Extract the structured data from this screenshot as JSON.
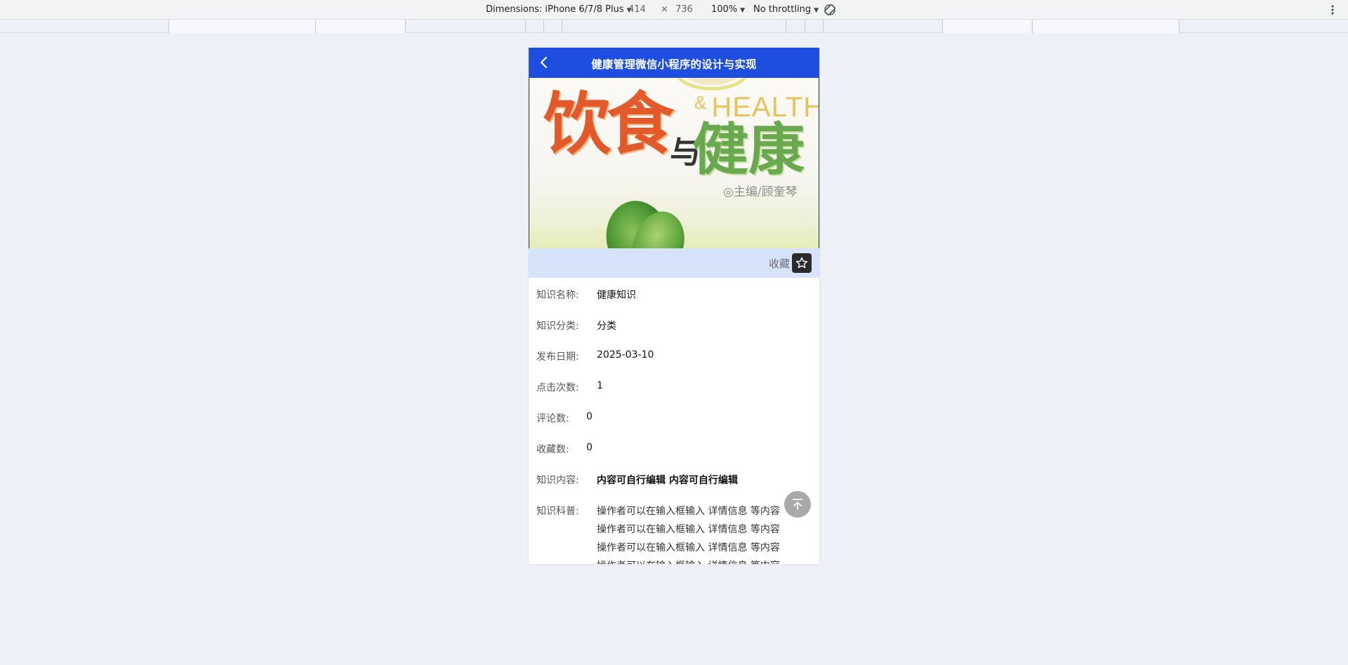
{
  "devtools": {
    "dimensions_label": "Dimensions: iPhone 6/7/8 Plus",
    "width": "414",
    "times": "×",
    "height": "736",
    "zoom": "100%",
    "throttling": "No throttling"
  },
  "navbar": {
    "title": "健康管理微信小程序的设计与实现"
  },
  "cover": {
    "title_part1": "饮食",
    "connector": "与",
    "title_part2": "健康",
    "english_amp": "&",
    "english_word": "HEALTH",
    "editor": "◎主编/顾奎琴"
  },
  "favorite": {
    "label": "收藏"
  },
  "details": {
    "name_label": "知识名称:",
    "name_value": "健康知识",
    "category_label": "知识分类:",
    "category_value": "分类",
    "date_label": "发布日期:",
    "date_value": "2025-03-10",
    "clicks_label": "点击次数:",
    "clicks_value": "1",
    "comments_label": "评论数:",
    "comments_value": "0",
    "collects_label": "收藏数:",
    "collects_value": "0",
    "content_label": "知识内容:",
    "content_value": "内容可自行编辑 内容可自行编辑",
    "popular_label": "知识科普:",
    "popular_lines": [
      "操作者可以在输入框输入 详情信息 等内容",
      "操作者可以在输入框输入 详情信息 等内容",
      "操作者可以在输入框输入 详情信息 等内容",
      "操作者可以在输入框输入 详情信息 等内容"
    ]
  }
}
